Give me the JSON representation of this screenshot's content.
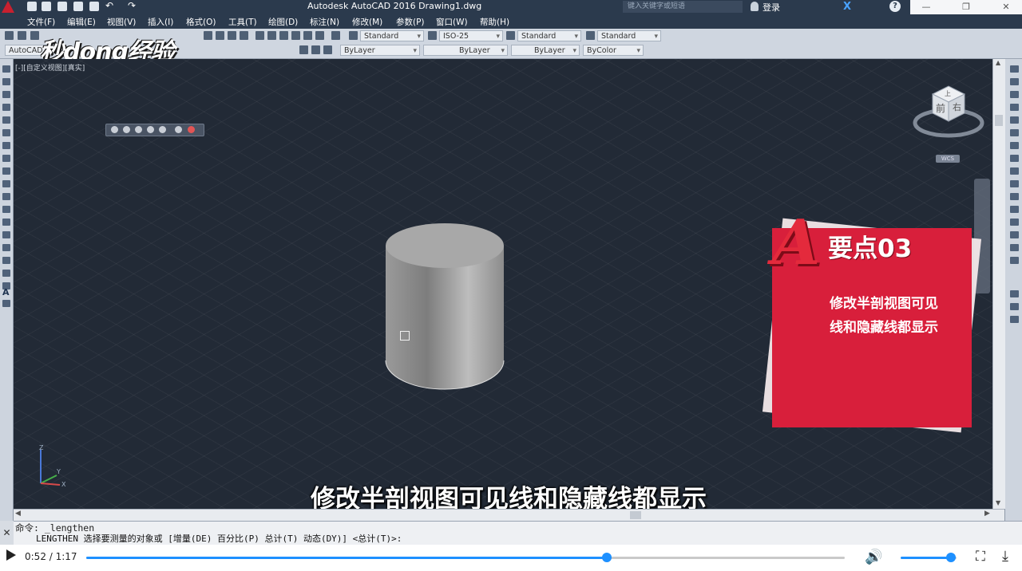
{
  "window": {
    "title": "Autodesk AutoCAD 2016    Drawing1.dwg",
    "search_placeholder": "键入关键字或短语",
    "login": "登录"
  },
  "menu": [
    "文件(F)",
    "编辑(E)",
    "视图(V)",
    "插入(I)",
    "格式(O)",
    "工具(T)",
    "绘图(D)",
    "标注(N)",
    "修改(M)",
    "参数(P)",
    "窗口(W)",
    "帮助(H)"
  ],
  "toolbar1": {
    "text_style": "Standard",
    "dim_style": "ISO-25",
    "table_style": "Standard",
    "multileader_style": "Standard"
  },
  "toolbar2": {
    "workspace": "AutoCAD",
    "layer": "ByLayer",
    "linetype": "ByLayer",
    "lineweight": "ByLayer",
    "color": "ByColor"
  },
  "watermark": "秒dong经验",
  "viewport": {
    "label": "[-][自定义视图][真实]",
    "viewcube_faces": [
      "前",
      "右",
      "上"
    ],
    "wcs_label": "WCS",
    "ucs_axes": [
      "Z",
      "Y",
      "X"
    ]
  },
  "card": {
    "title": "要点03",
    "body_line1": "修改半剖视图可见",
    "body_line2": "线和隐藏线都显示"
  },
  "subtitle": "修改半剖视图可见线和隐藏线都显示",
  "command": {
    "prompt_line": "命令: _lengthen",
    "history_line": "LENGTHEN 选择要测量的对象或 [增量(DE) 百分比(P) 总计(T) 动态(DY)] <总计(T)>:"
  },
  "video": {
    "current_time": "0:52",
    "total_time": "1:17",
    "time_display": "0:52 / 1:17",
    "progress": 0.686,
    "volume": 0.9
  },
  "colors": {
    "card_red": "#d81f3b",
    "viewport_bg": "#222a36",
    "accent_blue": "#1e90ff"
  }
}
